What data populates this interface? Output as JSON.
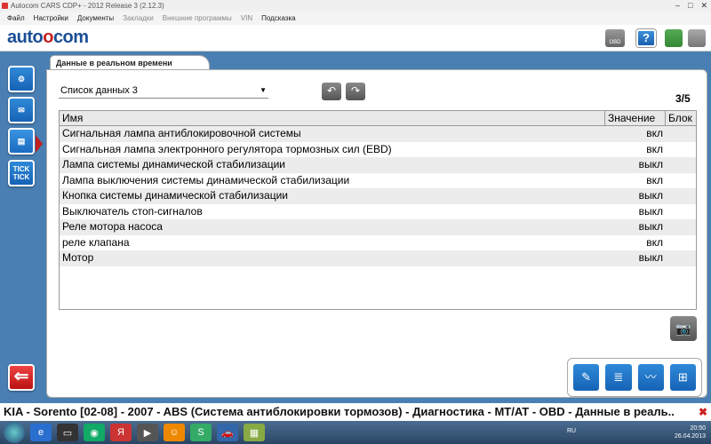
{
  "window": {
    "title": "Autocom CARS CDP+ - 2012 Release 3 (2.12.3)",
    "controls": [
      "–",
      "□",
      "✕"
    ]
  },
  "menu": {
    "items": [
      "Файл",
      "Настройки",
      "Документы",
      "Закладки",
      "Внешние программы",
      "VIN",
      "Подсказка"
    ]
  },
  "brand": {
    "logo_left": "auto",
    "logo_o": "o",
    "logo_right": "com",
    "obd_label": "OBD"
  },
  "tab": {
    "label": "Данные в реальном времени"
  },
  "list_select": {
    "value": "Список данных 3"
  },
  "pager": "3/5",
  "table": {
    "headers": [
      "Имя",
      "Значение",
      "Блок"
    ],
    "rows": [
      {
        "name": "Сигнальная лампа антиблокировочной системы",
        "value": "вкл"
      },
      {
        "name": "Сигнальная лампа электронного регулятора тормозных сил (EBD)",
        "value": "вкл"
      },
      {
        "name": "Лампа системы динамической стабилизации",
        "value": "выкл"
      },
      {
        "name": "Лампа выключения системы динамической стабилизации",
        "value": "вкл"
      },
      {
        "name": "Кнопка системы динамической стабилизации",
        "value": "выкл"
      },
      {
        "name": "Выключатель стоп-сигналов",
        "value": "выкл"
      },
      {
        "name": "Реле мотора насоса",
        "value": "выкл"
      },
      {
        "name": "реле клапана",
        "value": "вкл"
      },
      {
        "name": "Мотор",
        "value": "выкл"
      }
    ]
  },
  "nav": {
    "tick_label": "TICK TICK"
  },
  "status": {
    "text": "KIA - Sorento [02-08] - 2007 - ABS (Система антиблокировки тормозов) - Диагностика - MT/AT - OBD - Данные в реаль.."
  },
  "taskbar": {
    "lang": "RU",
    "time": "20:50",
    "date": "26.04.2013"
  },
  "colors": {
    "accent_blue": "#1663b6",
    "background": "#4a7fb3",
    "back_red": "#c02020"
  }
}
